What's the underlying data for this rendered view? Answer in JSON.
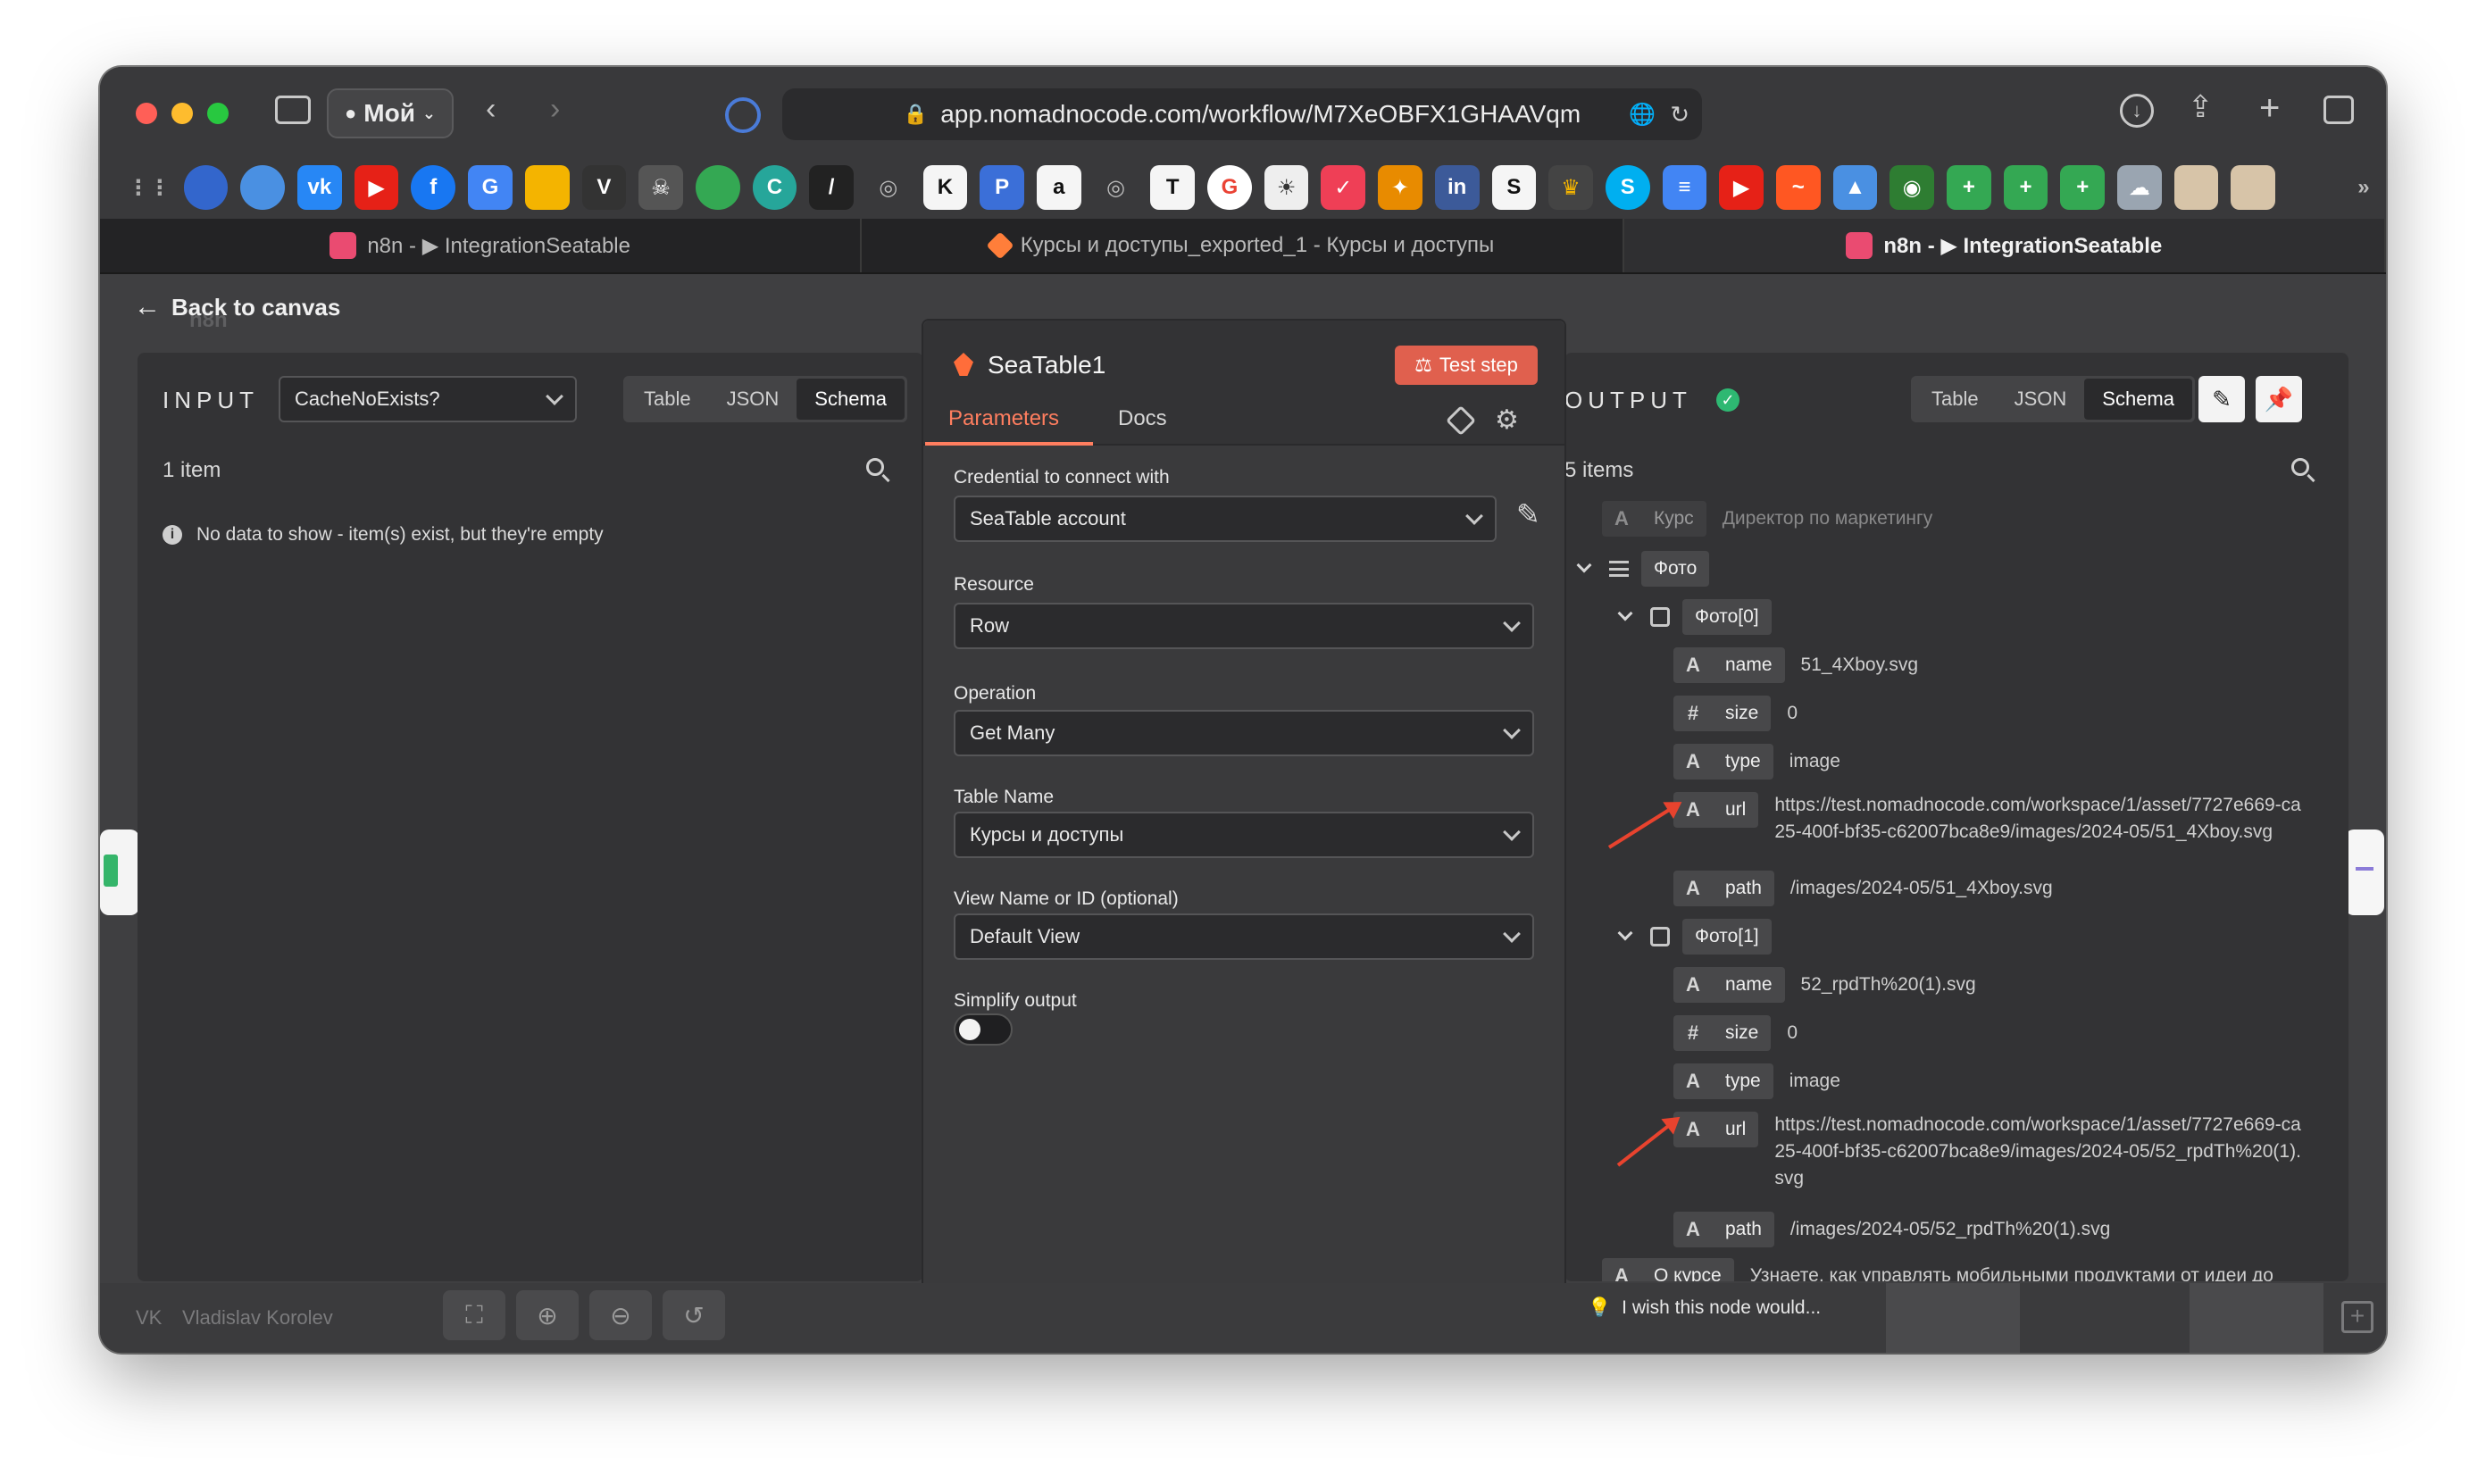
{
  "browser": {
    "profile_label": "Мой",
    "url": "app.nomadnocode.com/workflow/M7XeOBFX1GHAAVqm",
    "tabs": [
      {
        "label": "n8n - ▶ IntegrationSeatable"
      },
      {
        "label": "Курсы и доступы_exported_1 - Курсы и доступы"
      },
      {
        "label": "n8n - ▶ IntegrationSeatable"
      }
    ],
    "bookmark_icons": [
      "apps-icon",
      "vpn-icon",
      "globe-icon",
      "vk-icon",
      "youtube-icon",
      "facebook-icon",
      "translate-icon",
      "shield-icon",
      "v-icon",
      "skull-icon",
      "chrome-icon",
      "c-icon",
      "pen-icon",
      "web-icon",
      "k-icon",
      "p-icon",
      "amazon-icon",
      "web-icon",
      "t-icon",
      "google-icon",
      "bulb-icon",
      "pocket-icon",
      "hawk-icon",
      "in-icon",
      "s-icon",
      "crown-icon",
      "skype-icon",
      "docs-icon",
      "youtube-icon",
      "chart-icon",
      "mountain-icon",
      "eye-icon",
      "plus-icon",
      "plus-icon",
      "plus-icon",
      "cloud-icon",
      "folder-icon",
      "folder-icon"
    ]
  },
  "app": {
    "back_label": "Back to canvas",
    "canvas_label": "n8n",
    "input": {
      "title": "INPUT",
      "source_node": "CacheNoExists?",
      "views": [
        "Table",
        "JSON",
        "Schema"
      ],
      "item_count": "1 item",
      "empty_message": "No data to show - item(s) exist, but they're empty"
    },
    "node": {
      "name": "SeaTable1",
      "test_button": "Test step",
      "tabs": [
        "Parameters",
        "Docs"
      ],
      "fields": [
        {
          "label": "Credential to connect with",
          "value": "SeaTable account"
        },
        {
          "label": "Resource",
          "value": "Row"
        },
        {
          "label": "Operation",
          "value": "Get Many"
        },
        {
          "label": "Table Name",
          "value": "Курсы и доступы"
        },
        {
          "label": "View Name or ID (optional)",
          "value": "Default View"
        }
      ],
      "simplify_label": "Simplify output",
      "simplify_on": false
    },
    "output": {
      "title": "OUTPUT",
      "views": [
        "Table",
        "JSON",
        "Schema"
      ],
      "item_count": "5 items",
      "clipped_top_row": {
        "key": "Курс",
        "value": "Директор по маркетингу"
      },
      "photo_key": "Фото",
      "photos": [
        {
          "key": "Фото[0]",
          "name": "51_4Xboy.svg",
          "size": "0",
          "type": "image",
          "url": "https://test.nomadnocode.com/workspace/1/asset/7727e669-ca25-400f-bf35-c62007bca8e9/images/2024-05/51_4Xboy.svg",
          "path": "/images/2024-05/51_4Xboy.svg"
        },
        {
          "key": "Фото[1]",
          "name": "52_rpdTh%20(1).svg",
          "size": "0",
          "type": "image",
          "url": "https://test.nomadnocode.com/workspace/1/asset/7727e669-ca25-400f-bf35-c62007bca8e9/images/2024-05/52_rpdTh%20(1).svg",
          "path": "/images/2024-05/52_rpdTh%20(1).svg"
        }
      ],
      "about_key": "О курсе",
      "about_value": "Узнаете, как управлять мобильными продуктами от идеи до"
    },
    "bottom": {
      "user_initials": "VK",
      "user_name": "Vladislav Korolev",
      "feedback": "I wish this node would..."
    }
  },
  "colors": {
    "accent": "#ff7e5f",
    "test_button": "#e0604e",
    "success": "#2eb872",
    "annotation_arrow": "#e8432e"
  }
}
